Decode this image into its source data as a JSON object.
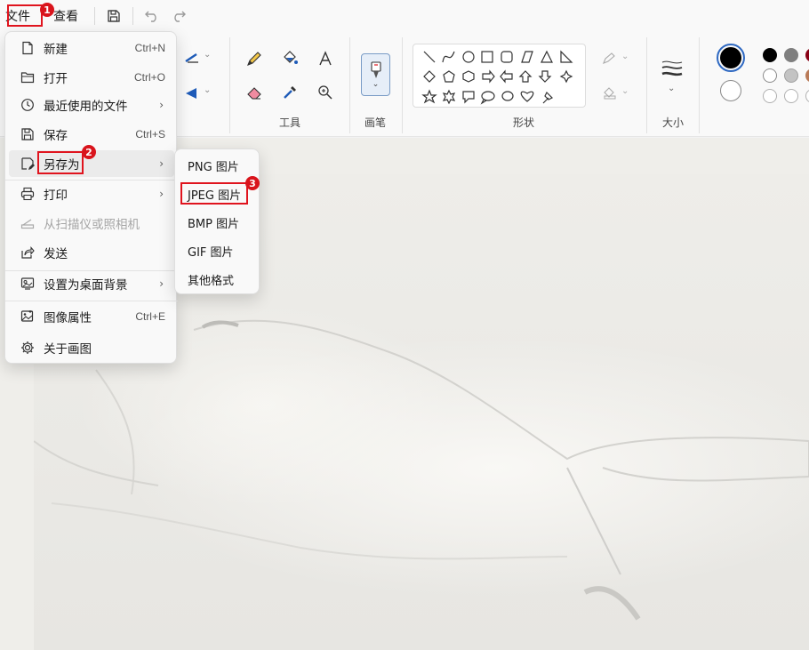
{
  "menubar": {
    "file_label": "文件",
    "view_label": "查看"
  },
  "ribbon": {
    "tools_label": "工具",
    "brush_label": "画笔",
    "shapes_label": "形状",
    "size_label": "大小"
  },
  "file_menu": {
    "items": [
      {
        "label": "新建",
        "shortcut": "Ctrl+N",
        "icon": "new-file-icon"
      },
      {
        "label": "打开",
        "shortcut": "Ctrl+O",
        "icon": "folder-open-icon"
      },
      {
        "label": "最近使用的文件",
        "arrow": "›",
        "icon": "recent-clock-icon"
      },
      {
        "label": "保存",
        "shortcut": "Ctrl+S",
        "icon": "save-icon"
      },
      {
        "label": "另存为",
        "arrow": "›",
        "icon": "save-as-icon"
      },
      {
        "label": "打印",
        "arrow": "›",
        "icon": "print-icon"
      },
      {
        "label": "从扫描仪或照相机",
        "icon": "scanner-icon",
        "disabled": true
      },
      {
        "label": "发送",
        "icon": "share-icon"
      },
      {
        "label": "设置为桌面背景",
        "arrow": "›",
        "icon": "desktop-background-icon"
      },
      {
        "label": "图像属性",
        "shortcut": "Ctrl+E",
        "icon": "image-properties-icon"
      },
      {
        "label": "关于画图",
        "icon": "gear-icon"
      }
    ]
  },
  "save_as_menu": {
    "items": [
      {
        "label": "PNG 图片"
      },
      {
        "label": "JPEG 图片"
      },
      {
        "label": "BMP 图片"
      },
      {
        "label": "GIF 图片"
      },
      {
        "label": "其他格式"
      }
    ]
  },
  "annotations": {
    "step1": "1",
    "step2": "2",
    "step3": "3"
  },
  "colors": {
    "accent_red": "#e0141e",
    "primary_color": "#000000",
    "secondary_color": "#ffffff"
  }
}
